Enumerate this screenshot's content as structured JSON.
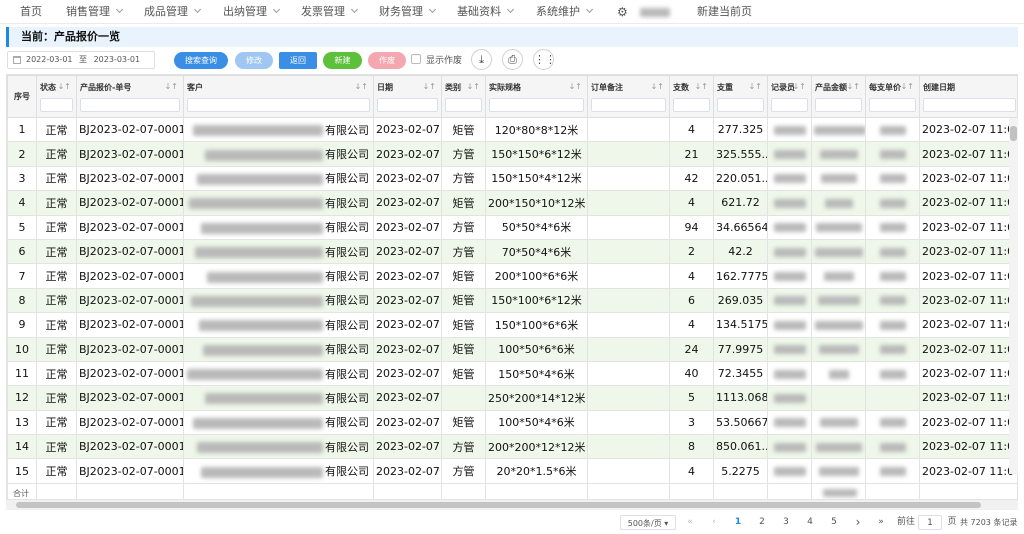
{
  "nav": {
    "home": "首页",
    "items": [
      "销售管理",
      "成品管理",
      "出纳管理",
      "发票管理",
      "财务管理",
      "基础资料",
      "系统维护"
    ],
    "new_page": "新建当前页"
  },
  "breadcrumb": "当前：产品报价一览",
  "toolbar": {
    "date_from": "2022-03-01",
    "date_sep": "至",
    "date_to": "2023-03-01",
    "search": "搜索查询",
    "edit": "修改",
    "back": "返回",
    "new": "新建",
    "void": "作废",
    "show_void": "显示作废"
  },
  "columns": [
    "序号",
    "状态",
    "产品报价-单号",
    "客户",
    "日期",
    "类别",
    "实际规格",
    "订单备注",
    "支数",
    "支重",
    "记录员",
    "产品金额",
    "每支单价",
    "创建日期"
  ],
  "rows": [
    {
      "n": "1",
      "status": "正常",
      "no": "BJ2023-02-07-0001",
      "cust": "有限公司",
      "date": "2023-02-07",
      "cat": "矩管",
      "spec": "120*80*8*12米",
      "qty": "4",
      "wt": "277.325",
      "created": "2023-02-07 11:0"
    },
    {
      "n": "2",
      "status": "正常",
      "no": "BJ2023-02-07-0001",
      "cust": "有限公司",
      "date": "2023-02-07",
      "cat": "方管",
      "spec": "150*150*6*12米",
      "qty": "21",
      "wt": "325.555...",
      "created": "2023-02-07 11:0"
    },
    {
      "n": "3",
      "status": "正常",
      "no": "BJ2023-02-07-0001",
      "cust": "有限公司",
      "date": "2023-02-07",
      "cat": "方管",
      "spec": "150*150*4*12米",
      "qty": "42",
      "wt": "220.051...",
      "created": "2023-02-07 11:0"
    },
    {
      "n": "4",
      "status": "正常",
      "no": "BJ2023-02-07-0001",
      "cust": "有限公司",
      "date": "2023-02-07",
      "cat": "矩管",
      "spec": "200*150*10*12米",
      "qty": "4",
      "wt": "621.72",
      "created": "2023-02-07 11:0"
    },
    {
      "n": "5",
      "status": "正常",
      "no": "BJ2023-02-07-0001",
      "cust": "有限公司",
      "date": "2023-02-07",
      "cat": "方管",
      "spec": "50*50*4*6米",
      "qty": "94",
      "wt": "34.66564",
      "created": "2023-02-07 11:0"
    },
    {
      "n": "6",
      "status": "正常",
      "no": "BJ2023-02-07-0001",
      "cust": "有限公司",
      "date": "2023-02-07",
      "cat": "方管",
      "spec": "70*50*4*6米",
      "qty": "2",
      "wt": "42.2",
      "created": "2023-02-07 11:0"
    },
    {
      "n": "7",
      "status": "正常",
      "no": "BJ2023-02-07-0001",
      "cust": "有限公司",
      "date": "2023-02-07",
      "cat": "矩管",
      "spec": "200*100*6*6米",
      "qty": "4",
      "wt": "162.7775",
      "created": "2023-02-07 11:0"
    },
    {
      "n": "8",
      "status": "正常",
      "no": "BJ2023-02-07-0001",
      "cust": "有限公司",
      "date": "2023-02-07",
      "cat": "矩管",
      "spec": "150*100*6*12米",
      "qty": "6",
      "wt": "269.035",
      "created": "2023-02-07 11:0"
    },
    {
      "n": "9",
      "status": "正常",
      "no": "BJ2023-02-07-0001",
      "cust": "有限公司",
      "date": "2023-02-07",
      "cat": "矩管",
      "spec": "150*100*6*6米",
      "qty": "4",
      "wt": "134.5175",
      "created": "2023-02-07 11:0"
    },
    {
      "n": "10",
      "status": "正常",
      "no": "BJ2023-02-07-0001",
      "cust": "有限公司",
      "date": "2023-02-07",
      "cat": "矩管",
      "spec": "100*50*6*6米",
      "qty": "24",
      "wt": "77.9975",
      "created": "2023-02-07 11:0"
    },
    {
      "n": "11",
      "status": "正常",
      "no": "BJ2023-02-07-0001",
      "cust": "有限公司",
      "date": "2023-02-07",
      "cat": "矩管",
      "spec": "150*50*4*6米",
      "qty": "40",
      "wt": "72.3455",
      "created": "2023-02-07 11:0"
    },
    {
      "n": "12",
      "status": "正常",
      "no": "BJ2023-02-07-0001",
      "cust": "有限公司",
      "date": "2023-02-07",
      "cat": "",
      "spec": "250*200*14*12米",
      "qty": "5",
      "wt": "1113.068",
      "created": "2023-02-07 11:0"
    },
    {
      "n": "13",
      "status": "正常",
      "no": "BJ2023-02-07-0001",
      "cust": "有限公司",
      "date": "2023-02-07",
      "cat": "矩管",
      "spec": "100*50*4*6米",
      "qty": "3",
      "wt": "53.50667",
      "created": "2023-02-07 11:0"
    },
    {
      "n": "14",
      "status": "正常",
      "no": "BJ2023-02-07-0001",
      "cust": "有限公司",
      "date": "2023-02-07",
      "cat": "方管",
      "spec": "200*200*12*12米",
      "qty": "8",
      "wt": "850.061...",
      "created": "2023-02-07 11:0"
    },
    {
      "n": "15",
      "status": "正常",
      "no": "BJ2023-02-07-0001",
      "cust": "有限公司",
      "date": "2023-02-07",
      "cat": "方管",
      "spec": "20*20*1.5*6米",
      "qty": "4",
      "wt": "5.2275",
      "created": "2023-02-07 11:0"
    }
  ],
  "footer": {
    "total_label": "合计"
  },
  "pager": {
    "page_size": "500条/页",
    "pages": [
      "1",
      "2",
      "3",
      "4",
      "5"
    ],
    "current": "1",
    "goto_label": "前往",
    "goto_value": "1",
    "page_unit": "页",
    "total": "共 7203 条记录"
  },
  "colors": {
    "accent": "#1e88e5",
    "row_alt": "#eef7e9",
    "btn_search": "#3a8ee6",
    "btn_edit": "#9fc7f2",
    "btn_back": "#3a8ee6",
    "btn_new": "#5cc03a",
    "btn_void": "#f5a7b0"
  }
}
